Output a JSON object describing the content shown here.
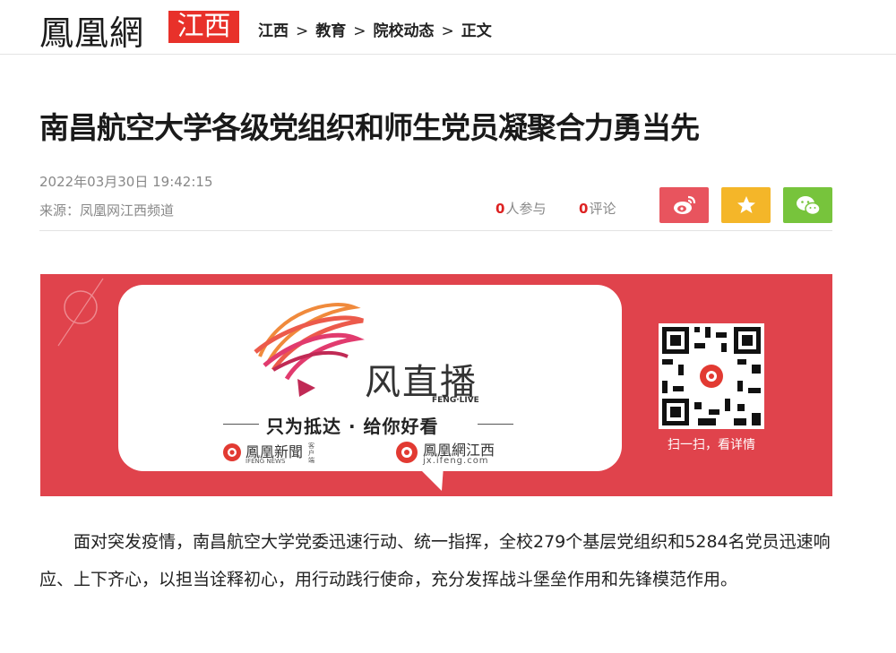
{
  "header": {
    "logo": "鳳凰網",
    "region": "江西",
    "breadcrumb": [
      {
        "label": "江西"
      },
      {
        "label": "教育"
      },
      {
        "label": "院校动态"
      },
      {
        "label": "正文"
      }
    ],
    "separator": ">"
  },
  "article": {
    "title": "南昌航空大学各级党组织和师生党员凝聚合力勇当先",
    "date": "2022年03月30日 19:42:15",
    "source": "来源：凤凰网江西频道",
    "participants_count": "0",
    "participants_label": "人参与",
    "comments_count": "0",
    "comments_label": "评论",
    "paragraph": "面对突发疫情，南昌航空大学党委迅速行动、统一指挥，全校279个基层党组织和5284名党员迅速响应、上下齐心，以担当诠释初心，用行动践行使命，充分发挥战斗堡垒作用和先锋模范作用。"
  },
  "share": {
    "weibo": {
      "icon": "weibo-icon",
      "color": "#e8545e"
    },
    "favorite": {
      "icon": "star-icon",
      "color": "#f4b629"
    },
    "wechat": {
      "icon": "wechat-icon",
      "color": "#77c43c"
    }
  },
  "banner": {
    "brand": "风直播",
    "brand_sub": "FENG·LIVE",
    "slogan": "只为抵达 · 给你好看",
    "logo_news": "鳳凰新聞",
    "logo_news_en": "IFENG NEWS",
    "logo_news_tag": "客户端",
    "logo_jx": "鳳凰網江西",
    "logo_jx_url": "jx.ifeng.com",
    "qr_caption": "扫一扫，看详情",
    "bg_color": "#e0434c"
  }
}
